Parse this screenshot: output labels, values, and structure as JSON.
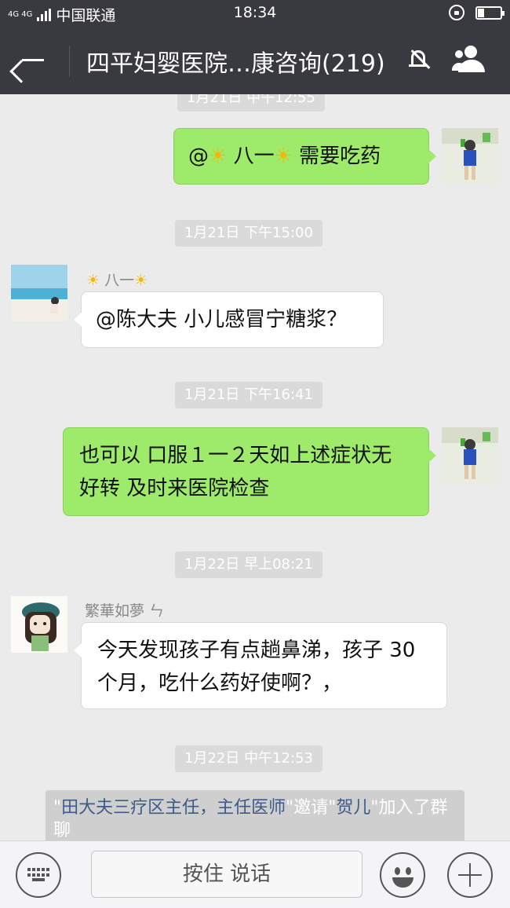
{
  "status_bar": {
    "network": "4G 4G",
    "carrier": "中国联通",
    "time": "18:34"
  },
  "header": {
    "title": "四平妇婴医院…康咨询(219)",
    "back_icon": "back-arrow-icon",
    "mute_icon": "bell-muted-icon",
    "members_icon": "group-members-icon"
  },
  "messages": [
    {
      "type": "timestamp",
      "text": "1月21日 中午12:55"
    },
    {
      "type": "outgoing",
      "parts": [
        "@",
        "☀",
        " 八一",
        "☀",
        "  需要吃药"
      ]
    },
    {
      "type": "timestamp",
      "text": "1月21日 下午15:00"
    },
    {
      "type": "incoming",
      "sender_parts": [
        "☀",
        " 八一",
        "☀"
      ],
      "line1": "@陈大夫  小儿感冒宁糖浆？"
    },
    {
      "type": "timestamp",
      "text": "1月21日 下午16:41"
    },
    {
      "type": "outgoing",
      "line1": "也可以  口服１一２天如上述症状无",
      "line2": "好转  及时来医院检查"
    },
    {
      "type": "timestamp",
      "text": "1月22日 早上08:21"
    },
    {
      "type": "incoming",
      "sender": "繁華如夢 ㄣ",
      "line1": "今天发现孩子有点趟鼻涕，孩子 30",
      "line2": "个月，吃什么药好使啊？，"
    },
    {
      "type": "timestamp",
      "text": "1月22日 中午12:53"
    },
    {
      "type": "system",
      "q1": "\"",
      "name1": "田大夫三疗区主任，主任医师",
      "q2": "\"",
      "mid1": "邀请",
      "q3": "\"",
      "name2": "贺儿",
      "q4": "\"",
      "tail": "加入了群聊"
    }
  ],
  "input_bar": {
    "keyboard_icon": "keyboard-icon",
    "hold_to_talk": "按住 说话",
    "emoji_icon": "emoji-icon",
    "plus_icon": "plus-icon"
  },
  "colors": {
    "header_bg": "#393a3f",
    "chat_bg": "#ebebeb",
    "outgoing_bubble": "#9eea6a",
    "incoming_bubble": "#ffffff",
    "timestamp_bg": "#dadada"
  }
}
